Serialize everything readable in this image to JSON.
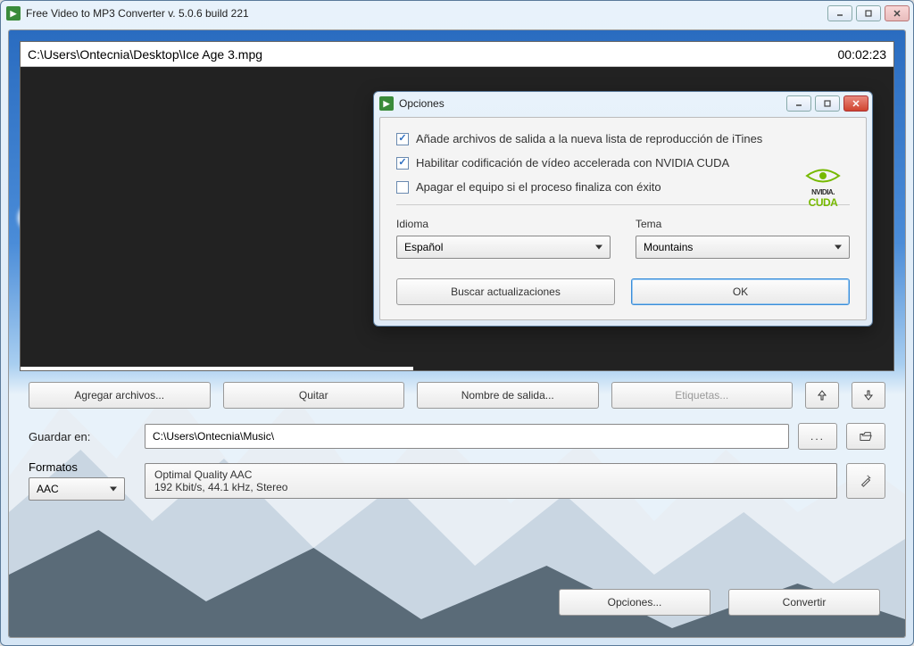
{
  "window": {
    "title": "Free Video to MP3 Converter  v. 5.0.6 build 221"
  },
  "preview": {
    "path": "C:\\Users\\Ontecnia\\Desktop\\Ice Age 3.mpg",
    "duration": "00:02:23"
  },
  "toolbar": {
    "add": "Agregar archivos...",
    "remove": "Quitar",
    "output_name": "Nombre de salida...",
    "tags": "Etiquetas..."
  },
  "save": {
    "label": "Guardar en:",
    "path": "C:\\Users\\Ontecnia\\Music\\"
  },
  "formats": {
    "label": "Formatos",
    "codec": "AAC",
    "quality_title": "Optimal Quality AAC",
    "quality_detail": "192 Kbit/s, 44.1 kHz, Stereo"
  },
  "bottom": {
    "options": "Opciones...",
    "convert": "Convertir"
  },
  "modal": {
    "title": "Opciones",
    "opt1": "Añade archivos de salida a la nueva lista de reproducción de iTines",
    "opt2": "Habilitar codificación de vídeo accelerada con NVIDIA CUDA",
    "opt3": "Apagar el equipo si el proceso finaliza con éxito",
    "opt1_checked": true,
    "opt2_checked": true,
    "opt3_checked": false,
    "language_label": "Idioma",
    "language_value": "Español",
    "theme_label": "Tema",
    "theme_value": "Mountains",
    "updates": "Buscar actualizaciones",
    "ok": "OK",
    "cuda_brand": "NVIDIA.",
    "cuda_name": "CUDA"
  }
}
